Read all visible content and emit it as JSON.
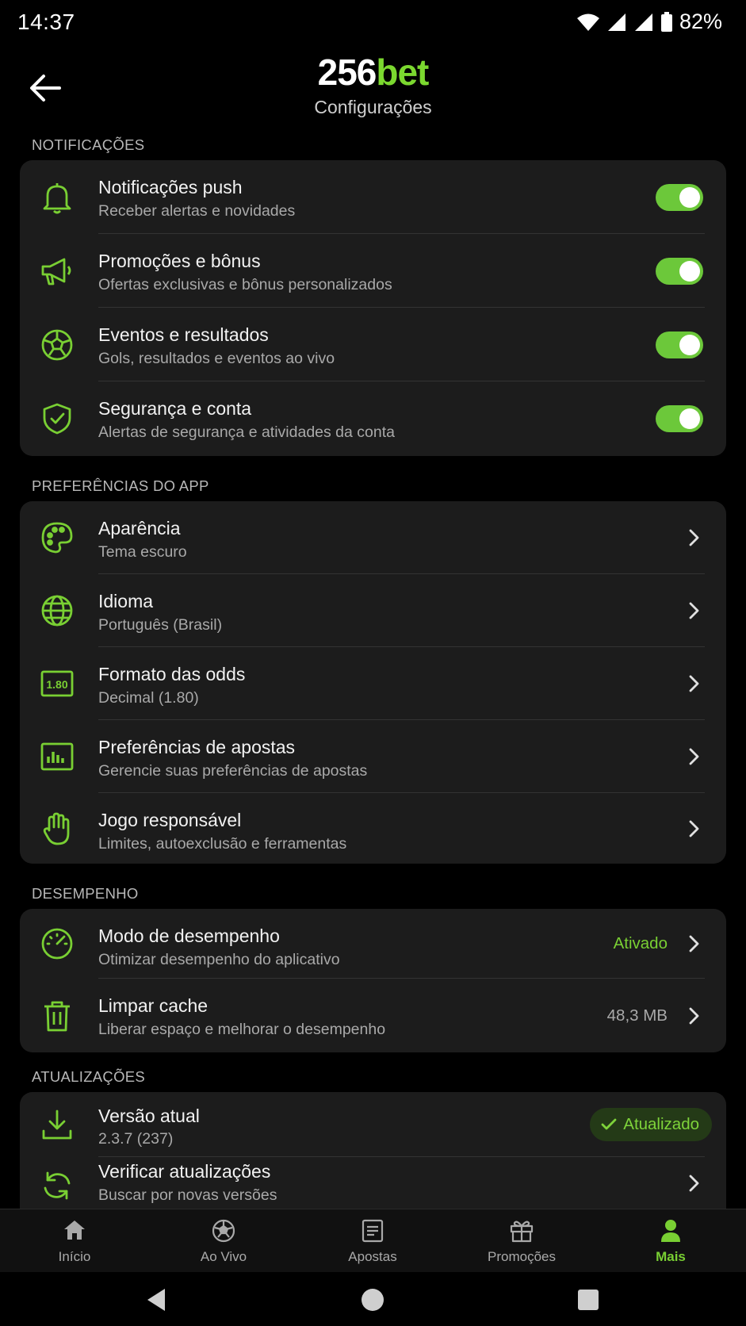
{
  "status_bar": {
    "time": "14:37",
    "battery": "82%"
  },
  "header": {
    "brand_number": "256",
    "brand_word": "bet",
    "title": "Configurações"
  },
  "sections": {
    "notifications": {
      "title": "NOTIFICAÇÕES",
      "items": [
        {
          "title": "Notificações push",
          "subtitle": "Receber alertas e novidades",
          "icon": "bell-icon",
          "enabled": true
        },
        {
          "title": "Promoções e bônus",
          "subtitle": "Ofertas exclusivas e bônus personalizados",
          "icon": "megaphone-icon",
          "enabled": true
        },
        {
          "title": "Eventos e resultados",
          "subtitle": "Gols, resultados e eventos ao vivo",
          "icon": "soccer-ball-icon",
          "enabled": true
        },
        {
          "title": "Segurança e conta",
          "subtitle": "Alertas de segurança e atividades da conta",
          "icon": "shield-check-icon",
          "enabled": true
        }
      ]
    },
    "app_prefs": {
      "title": "PREFERÊNCIAS DO APP",
      "items": [
        {
          "title": "Aparência",
          "subtitle": "Tema escuro",
          "icon": "palette-icon"
        },
        {
          "title": "Idioma",
          "subtitle": "Português (Brasil)",
          "icon": "globe-icon"
        },
        {
          "title": "Formato das odds",
          "subtitle": "Decimal (1.80)",
          "icon": "odds-format-icon",
          "icon_text": "1.80"
        },
        {
          "title": "Preferências de apostas",
          "subtitle": "Gerencie suas preferências de apostas",
          "icon": "bet-chart-icon"
        },
        {
          "title": "Jogo responsável",
          "subtitle": "Limites, autoexclusão e ferramentas",
          "icon": "hand-icon"
        }
      ]
    },
    "performance": {
      "title": "DESEMPENHO",
      "items": [
        {
          "title": "Modo de desempenho",
          "subtitle": "Otimizar desempenho do aplicativo",
          "value": "Ativado",
          "icon": "speedometer-icon"
        },
        {
          "title": "Limpar cache",
          "subtitle": "Liberar espaço e melhorar o desempenho",
          "value": "48,3 MB",
          "icon": "trash-icon"
        }
      ]
    },
    "updates": {
      "title": "ATUALIZAÇÕES",
      "items": [
        {
          "title": "Versão atual",
          "subtitle": "2.3.7 (237)",
          "badge": "Atualizado",
          "icon": "download-icon"
        },
        {
          "title": "Verificar atualizações",
          "subtitle": "Buscar por novas versões",
          "icon": "refresh-icon"
        }
      ]
    }
  },
  "tabbar": {
    "items": [
      {
        "label": "Início",
        "icon": "home-icon",
        "active": false
      },
      {
        "label": "Ao Vivo",
        "icon": "live-ball-icon",
        "active": false
      },
      {
        "label": "Apostas",
        "icon": "betslip-icon",
        "active": false
      },
      {
        "label": "Promoções",
        "icon": "gift-icon",
        "active": false
      },
      {
        "label": "Mais",
        "icon": "user-icon",
        "active": true
      }
    ]
  },
  "colors": {
    "accent": "#79cf33",
    "toggle_on": "#6cc83a",
    "card": "#1c1c1c",
    "background": "#000000"
  }
}
